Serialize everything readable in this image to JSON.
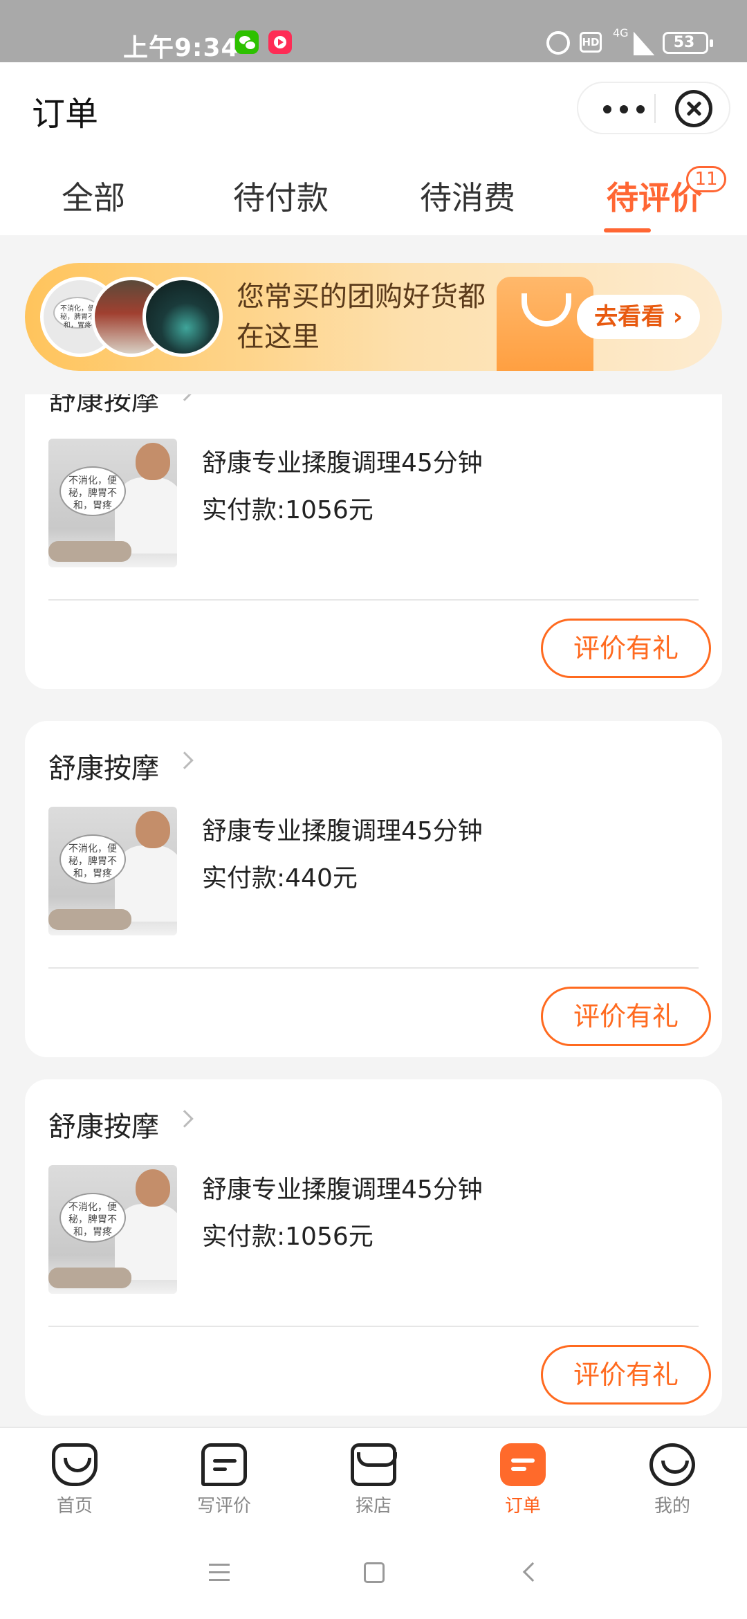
{
  "status_bar": {
    "time": "上午9:34",
    "network": "4G",
    "battery": "53",
    "hd": "HD"
  },
  "header": {
    "title": "订单"
  },
  "tabs": [
    {
      "label": "全部"
    },
    {
      "label": "待付款"
    },
    {
      "label": "待消费"
    },
    {
      "label": "待评价",
      "badge": "11",
      "active": true
    }
  ],
  "banner": {
    "text": "您常买的团购好货都在这里",
    "thumb_text": "不消化，便秘，脾胃不和，胃疼",
    "button": "去看看"
  },
  "orders": [
    {
      "shop": "舒康按摩",
      "product": "舒康专业揉腹调理45分钟",
      "price": "实付款:1056元",
      "image_text": "不消化，便秘，脾胃不和，胃疼",
      "action": "评价有礼"
    },
    {
      "shop": "舒康按摩",
      "product": "舒康专业揉腹调理45分钟",
      "price": "实付款:440元",
      "image_text": "不消化，便秘，脾胃不和，胃疼",
      "action": "评价有礼"
    },
    {
      "shop": "舒康按摩",
      "product": "舒康专业揉腹调理45分钟",
      "price": "实付款:1056元",
      "image_text": "不消化，便秘，脾胃不和，胃疼",
      "action": "评价有礼"
    }
  ],
  "bottom_nav": [
    {
      "label": "首页",
      "icon": "home-icon"
    },
    {
      "label": "写评价",
      "icon": "write-review-icon"
    },
    {
      "label": "探店",
      "icon": "shop-icon"
    },
    {
      "label": "订单",
      "icon": "order-icon",
      "active": true
    },
    {
      "label": "我的",
      "icon": "profile-icon"
    }
  ],
  "colors": {
    "accent": "#ff6633",
    "status_bar": "#a9a9a9",
    "page_background": "#f4f4f4"
  }
}
